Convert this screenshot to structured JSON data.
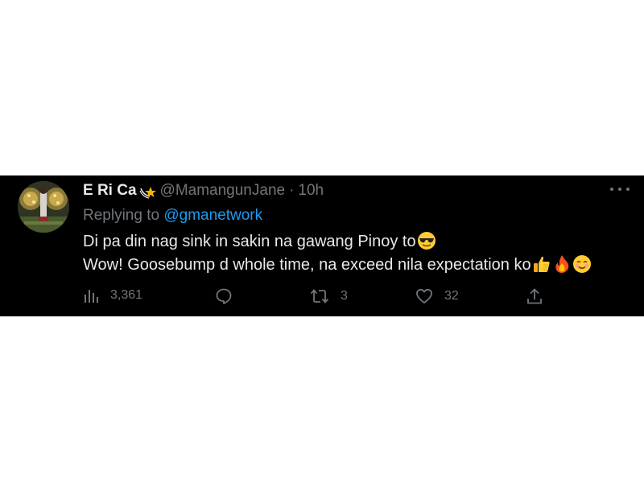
{
  "tweet": {
    "display_name": "E Ri Ca",
    "name_badge": "shooting-star-icon",
    "handle": "@MamangunJane",
    "separator": "·",
    "time": "10h",
    "replying_prefix": "Replying to",
    "replying_to": "@gmanetwork",
    "lines": [
      "Di pa din nag sink in sakin na gawang Pinoy to",
      "Wow! Goosebump d whole time, na exceed nila expectation ko"
    ],
    "emojis": {
      "line1": [
        "sunglasses-face-icon"
      ],
      "line2": [
        "thumbs-up-icon",
        "fire-icon",
        "smiling-face-icon"
      ]
    }
  },
  "actions": {
    "views": "3,361",
    "replies": "",
    "retweets": "3",
    "likes": "32"
  },
  "colors": {
    "background": "#000000",
    "text": "#e7e9ea",
    "muted": "#71767b",
    "link": "#1d9bf0"
  }
}
